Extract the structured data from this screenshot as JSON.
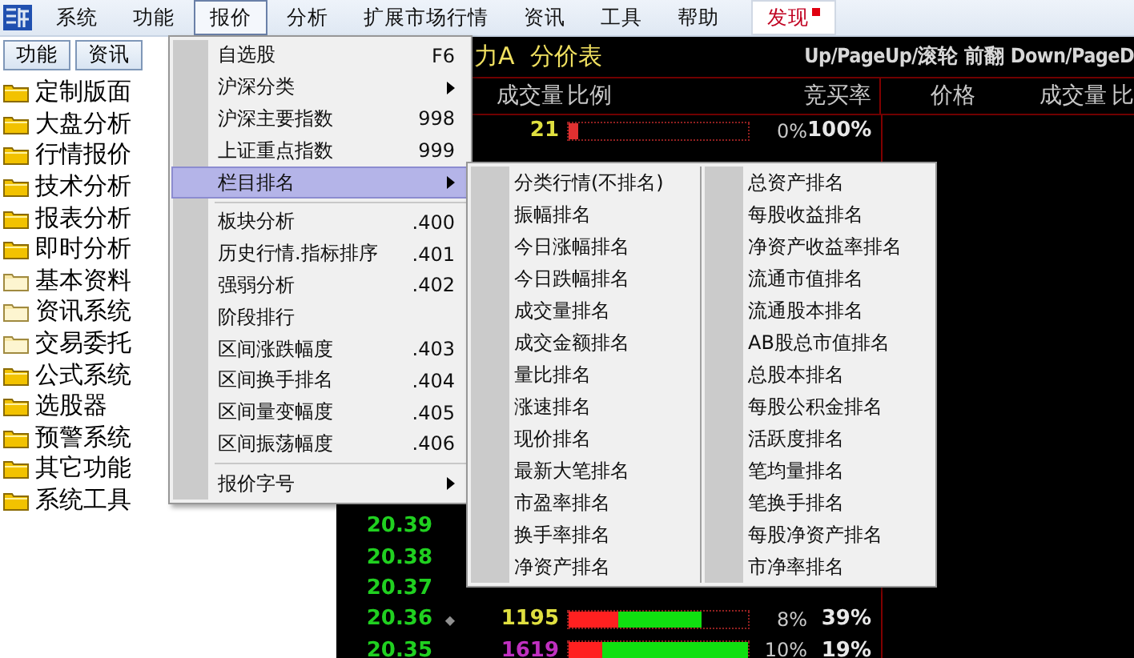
{
  "menubar": [
    {
      "label": "系统",
      "selected": false,
      "alert": false
    },
    {
      "label": "功能",
      "selected": false,
      "alert": false
    },
    {
      "label": "报价",
      "selected": true,
      "alert": false
    },
    {
      "label": "分析",
      "selected": false,
      "alert": false
    },
    {
      "label": "扩展市场行情",
      "selected": false,
      "alert": false
    },
    {
      "label": "资讯",
      "selected": false,
      "alert": false
    },
    {
      "label": "工具",
      "selected": false,
      "alert": false
    },
    {
      "label": "帮助",
      "selected": false,
      "alert": false
    },
    {
      "label": "发现",
      "selected": false,
      "alert": true
    }
  ],
  "sidebar": {
    "tabs": [
      "功能",
      "资讯"
    ],
    "items": [
      {
        "label": "定制版面",
        "kind": "folder"
      },
      {
        "label": "大盘分析",
        "kind": "folder"
      },
      {
        "label": "行情报价",
        "kind": "folder"
      },
      {
        "label": "技术分析",
        "kind": "folder"
      },
      {
        "label": "报表分析",
        "kind": "folder"
      },
      {
        "label": "即时分析",
        "kind": "folder"
      },
      {
        "label": "基本资料",
        "kind": "folder-light"
      },
      {
        "label": "资讯系统",
        "kind": "folder-light"
      },
      {
        "label": "交易委托",
        "kind": "folder-light"
      },
      {
        "label": "公式系统",
        "kind": "folder"
      },
      {
        "label": "选股器",
        "kind": "folder"
      },
      {
        "label": "预警系统",
        "kind": "folder"
      },
      {
        "label": "其它功能",
        "kind": "folder"
      },
      {
        "label": "系统工具",
        "kind": "folder"
      }
    ]
  },
  "quote": {
    "title": "力A  分价表",
    "hint": "Up/PageUp/滚轮 前翻 Down/PageD",
    "columns": [
      "成交量",
      "比例",
      "竞买率"
    ],
    "right_columns": [
      "价格",
      "成交量",
      "比"
    ],
    "rows": [
      {
        "volume": "21",
        "color": "#e0e040",
        "bar": [
          {
            "level": 0.05,
            "color": "#e03030"
          }
        ],
        "share": "0%",
        "ratio": "100%"
      }
    ],
    "lower_rows": [
      {
        "price": "20.39"
      },
      {
        "price": "20.38"
      },
      {
        "price": "20.37"
      },
      {
        "price": "20.36",
        "mark": "◆",
        "volume": "1195",
        "color": "#e0e040",
        "bar": [
          {
            "level": 0.28,
            "color": "#ff2020"
          },
          {
            "level": 0.46,
            "color": "#10e010"
          }
        ],
        "share": "8%",
        "ratio": "39%"
      },
      {
        "price": "20.35",
        "volume": "1619",
        "color": "#c030c0",
        "bar": [
          {
            "level": 0.19,
            "color": "#ff2020"
          },
          {
            "level": 0.81,
            "color": "#10e010"
          }
        ],
        "share": "10%",
        "ratio": "19%"
      }
    ]
  },
  "dropdown": [
    {
      "kind": "item",
      "label": "自选股",
      "shortcut": "F6",
      "selected": false
    },
    {
      "kind": "submenu",
      "label": "沪深分类",
      "selected": false
    },
    {
      "kind": "item",
      "label": "沪深主要指数",
      "shortcut": "998",
      "selected": false
    },
    {
      "kind": "item",
      "label": "上证重点指数",
      "shortcut": "999",
      "selected": false
    },
    {
      "kind": "submenu",
      "label": "栏目排名",
      "selected": true
    },
    {
      "kind": "separator"
    },
    {
      "kind": "item",
      "label": "板块分析",
      "shortcut": ".400",
      "selected": false
    },
    {
      "kind": "item",
      "label": "历史行情.指标排序",
      "shortcut": ".401",
      "selected": false
    },
    {
      "kind": "item",
      "label": "强弱分析",
      "shortcut": ".402",
      "selected": false
    },
    {
      "kind": "item",
      "label": "阶段排行",
      "selected": false
    },
    {
      "kind": "item",
      "label": "区间涨跌幅度",
      "shortcut": ".403",
      "selected": false
    },
    {
      "kind": "item",
      "label": "区间换手排名",
      "shortcut": ".404",
      "selected": false
    },
    {
      "kind": "item",
      "label": "区间量变幅度",
      "shortcut": ".405",
      "selected": false
    },
    {
      "kind": "item",
      "label": "区间振荡幅度",
      "shortcut": ".406",
      "selected": false
    },
    {
      "kind": "separator"
    },
    {
      "kind": "submenu",
      "label": "报价字号",
      "selected": false
    }
  ],
  "submenu": [
    [
      "分类行情(不排名)",
      "振幅排名",
      "今日涨幅排名",
      "今日跌幅排名",
      "成交量排名",
      "成交金额排名",
      "量比排名",
      "涨速排名",
      "现价排名",
      "最新大笔排名",
      "市盈率排名",
      "换手率排名",
      "净资产排名"
    ],
    [
      "总资产排名",
      "每股收益排名",
      "净资产收益率排名",
      "流通市值排名",
      "流通股本排名",
      "AB股总市值排名",
      "总股本排名",
      "每股公积金排名",
      "活跃度排名",
      "笔均量排名",
      "笔换手排名",
      "每股净资产排名",
      "市净率排名"
    ]
  ]
}
